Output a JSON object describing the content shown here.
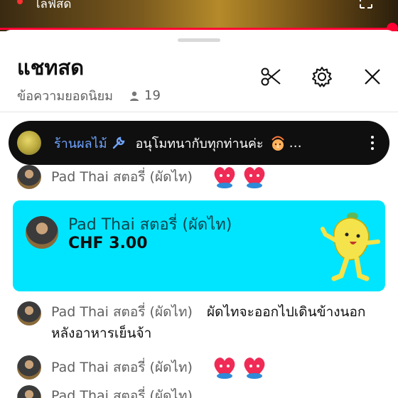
{
  "video": {
    "status_label": "ไลฟ์สด",
    "progress": 0.985
  },
  "chat": {
    "title": "แชทสด",
    "subtitle": "ข้อความยอดนิยม",
    "viewer_count": "19",
    "icons": {
      "cut": "scissors-icon",
      "settings": "gear-icon",
      "close": "close-icon"
    }
  },
  "pinned": {
    "author": "ร้านผลไม้",
    "author_badge": "wrench-icon",
    "text": "อนุโมทนากับทุกท่านค่ะ",
    "trailing_emoji": "praying-character-emoji",
    "ellipsis": "…"
  },
  "messages": [
    {
      "author": "Pad Thai สตอรี่ (ผัดไท)",
      "text": "",
      "emojis": [
        "heart-hug-emoji",
        "heart-hug-emoji"
      ]
    },
    {
      "author": "Pad Thai สตอรี่ (ผัดไท)",
      "text": "ผัดไทจะออกไปเดินข้างนอกหลังอาหารเย็นจ้า",
      "emojis": []
    },
    {
      "author": "Pad Thai สตอรี่ (ผัดไท)",
      "text": "",
      "emojis": [
        "heart-hug-emoji",
        "heart-hug-emoji"
      ]
    },
    {
      "author": "Pad Thai สตอรี่ (ผัดไท)",
      "text": "",
      "emojis": []
    }
  ],
  "superchat": {
    "author": "Pad Thai สตอรี่ (ผัดไท)",
    "amount": "CHF 3.00",
    "color": "#00e5ff",
    "sticker": "lemon-character-sticker"
  },
  "colors": {
    "accent": "#ff0033",
    "pinned_name": "#6fa4ff",
    "superchat": "#00e5ff"
  }
}
